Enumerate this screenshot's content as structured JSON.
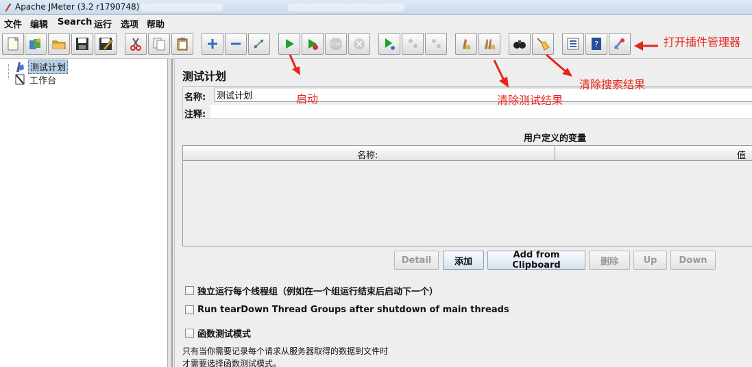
{
  "window": {
    "title": "Apache JMeter (3.2 r1790748)"
  },
  "menu": {
    "items": [
      "文件",
      "编辑",
      "Search",
      "运行",
      "选项",
      "帮助"
    ]
  },
  "toolbar": {
    "buttons": [
      {
        "name": "new-icon"
      },
      {
        "name": "templates-icon"
      },
      {
        "name": "open-icon"
      },
      {
        "name": "save-icon"
      },
      {
        "name": "save-as-icon"
      },
      {
        "name": "cut-icon"
      },
      {
        "name": "copy-icon"
      },
      {
        "name": "paste-icon"
      },
      {
        "name": "expand-icon"
      },
      {
        "name": "collapse-icon"
      },
      {
        "name": "toggle-icon"
      },
      {
        "name": "start-icon"
      },
      {
        "name": "start-no-pause-icon"
      },
      {
        "name": "stop-icon"
      },
      {
        "name": "shutdown-icon"
      },
      {
        "name": "remote-start-icon"
      },
      {
        "name": "remote-stop-icon"
      },
      {
        "name": "remote-shutdown-icon"
      },
      {
        "name": "clear-icon"
      },
      {
        "name": "clear-all-icon"
      },
      {
        "name": "search-icon"
      },
      {
        "name": "reset-search-icon"
      },
      {
        "name": "function-helper-icon"
      },
      {
        "name": "help-icon"
      },
      {
        "name": "plugins-manager-icon"
      }
    ]
  },
  "annotations": {
    "start": "启动",
    "clear_test_results": "清除测试结果",
    "clear_search_results": "清除搜索结果",
    "open_plugins_manager": "打开插件管理器"
  },
  "tree": {
    "items": [
      {
        "label": "测试计划",
        "selected": true
      },
      {
        "label": "工作台",
        "selected": false
      }
    ]
  },
  "main": {
    "title": "测试计划",
    "name_label": "名称:",
    "name_value": "测试计划",
    "comment_label": "注释:",
    "section_title": "用户定义的变量",
    "table": {
      "columns": [
        "名称:",
        "值"
      ]
    },
    "buttons": {
      "detail": "Detail",
      "add": "添加",
      "add_clipboard": "Add from Clipboard",
      "delete": "删除",
      "up": "Up",
      "down": "Down"
    },
    "checkboxes": {
      "independent": "独立运行每个线程组（例如在一个组运行结束后启动下一个）",
      "teardown": "Run tearDown Thread Groups after shutdown of main threads",
      "functional": "函数测试模式"
    },
    "note_line1": "只有当你需要记录每个请求从服务器取得的数据到文件时",
    "note_line2": "才需要选择函数测试模式。"
  }
}
